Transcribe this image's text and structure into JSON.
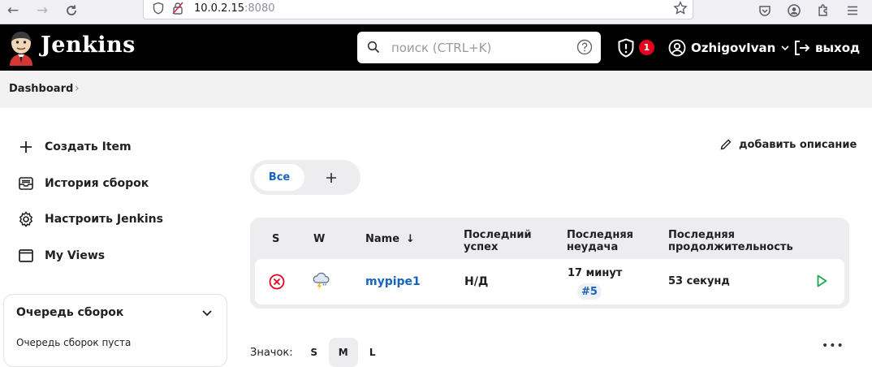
{
  "browser": {
    "url_host": "10.0.2.15",
    "url_port": ":8080"
  },
  "header": {
    "brand": "Jenkins",
    "search_placeholder": "поиск (CTRL+K)",
    "security_badge_count": "1",
    "user_name": "OzhigovIvan",
    "logout_label": "выход"
  },
  "breadcrumb": {
    "items": [
      "Dashboard"
    ]
  },
  "sidebar": {
    "items": [
      {
        "label": "Создать Item",
        "icon": "plus-icon"
      },
      {
        "label": "История сборок",
        "icon": "inbox-icon"
      },
      {
        "label": "Настроить Jenkins",
        "icon": "gear-icon"
      },
      {
        "label": "My Views",
        "icon": "window-icon"
      }
    ],
    "queue": {
      "title": "Очередь сборок",
      "empty_text": "Очередь сборок пуста"
    }
  },
  "main": {
    "add_description": "добавить описание",
    "tabs": [
      {
        "label": "Все",
        "active": true
      }
    ],
    "table": {
      "headers": {
        "s": "S",
        "w": "W",
        "name": "Name",
        "last_success_1": "Последний",
        "last_success_2": "успех",
        "last_failure_1": "Последняя",
        "last_failure_2": "неудача",
        "last_duration_1": "Последняя",
        "last_duration_2": "продолжительность"
      },
      "rows": [
        {
          "status_icon": "failed-icon",
          "weather_icon": "storm-icon",
          "name": "mypipe1",
          "last_success": "Н/Д",
          "last_failure": "17 минут",
          "last_failure_build": "#5",
          "last_duration": "53 секунд"
        }
      ]
    },
    "icon_size": {
      "label": "Значок:",
      "options": [
        "S",
        "M",
        "L"
      ],
      "selected": "M"
    }
  },
  "colors": {
    "header_bg": "#000000",
    "link": "#1565c0",
    "failure": "#e6001f",
    "run": "#1ea64b"
  }
}
